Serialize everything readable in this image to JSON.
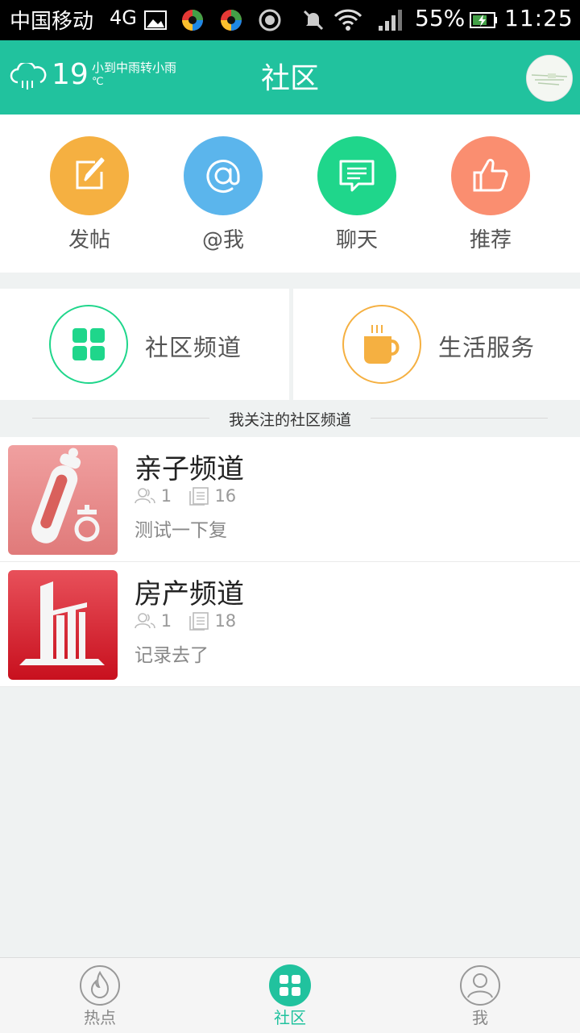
{
  "status_bar": {
    "carrier": "中国移动",
    "network": "4G",
    "battery_percent": "55%",
    "time": "11:25"
  },
  "header": {
    "temperature": "19",
    "temperature_unit": "℃",
    "weather": "小到中雨转小雨",
    "title": "社区"
  },
  "quick_actions": [
    {
      "label": "发帖",
      "icon": "edit-icon",
      "color": "#f5b041"
    },
    {
      "label": "@我",
      "icon": "at-icon",
      "color": "#5bb5ec"
    },
    {
      "label": "聊天",
      "icon": "chat-icon",
      "color": "#1fd68b"
    },
    {
      "label": "推荐",
      "icon": "thumbs-up-icon",
      "color": "#fa8e70"
    }
  ],
  "channels": [
    {
      "label": "社区频道",
      "icon": "grid-icon",
      "color": "#1fd68b"
    },
    {
      "label": "生活服务",
      "icon": "coffee-cup-icon",
      "color": "#f5b041"
    }
  ],
  "section_title": "我关注的社区频道",
  "followed_channels": [
    {
      "title": "亲子频道",
      "members": "1",
      "posts": "16",
      "last_post": "测试一下复"
    },
    {
      "title": "房产频道",
      "members": "1",
      "posts": "18",
      "last_post": "记录去了"
    }
  ],
  "bottom_nav": [
    {
      "label": "热点",
      "icon": "flame-icon",
      "active": false
    },
    {
      "label": "社区",
      "icon": "grid-icon",
      "active": true
    },
    {
      "label": "我",
      "icon": "user-icon",
      "active": false
    }
  ],
  "colors": {
    "brand": "#21c29e",
    "page_background": "#eff2f2"
  }
}
